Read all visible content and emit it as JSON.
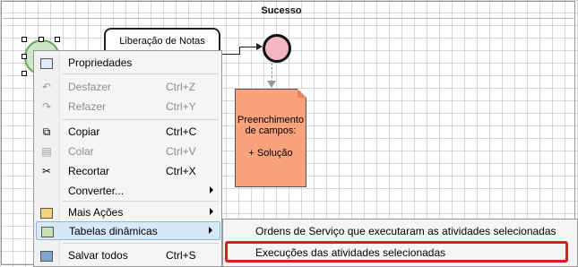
{
  "diagram": {
    "lane_title": "Sucesso",
    "task_label": "Liberação de Notas",
    "note_line1": "Preenchimento",
    "note_line2": "de campos:",
    "note_line3": "+ Solução"
  },
  "context_menu": {
    "items": [
      {
        "label": "Propriedades",
        "shortcut": "",
        "icon": "properties-icon",
        "disabled": false
      },
      {
        "label": "Desfazer",
        "shortcut": "Ctrl+Z",
        "icon": "undo-icon",
        "disabled": true
      },
      {
        "label": "Refazer",
        "shortcut": "Ctrl+Y",
        "icon": "redo-icon",
        "disabled": true
      },
      {
        "label": "Copiar",
        "shortcut": "Ctrl+C",
        "icon": "copy-icon",
        "disabled": false
      },
      {
        "label": "Colar",
        "shortcut": "Ctrl+V",
        "icon": "paste-icon",
        "disabled": true
      },
      {
        "label": "Recortar",
        "shortcut": "Ctrl+X",
        "icon": "cut-icon",
        "disabled": false
      },
      {
        "label": "Converter...",
        "shortcut": "",
        "icon": "",
        "disabled": false
      },
      {
        "label": "Mais Ações",
        "shortcut": "",
        "icon": "more-actions-icon",
        "disabled": false
      },
      {
        "label": "Tabelas dinâmicas",
        "shortcut": "",
        "icon": "pivot-table-icon",
        "disabled": false
      },
      {
        "label": "Salvar todos",
        "shortcut": "Ctrl+S",
        "icon": "save-all-icon",
        "disabled": false
      }
    ]
  },
  "submenu": {
    "items": [
      {
        "label": "Ordens de Serviço que executaram as atividades selecionadas"
      },
      {
        "label": "Execuções das atividades selecionadas"
      }
    ]
  },
  "colors": {
    "highlight": "#d7e8f7",
    "annotation_red": "#dd1e1e",
    "note_fill": "#f9a27b",
    "end_event_fill": "#f4b7c0"
  }
}
